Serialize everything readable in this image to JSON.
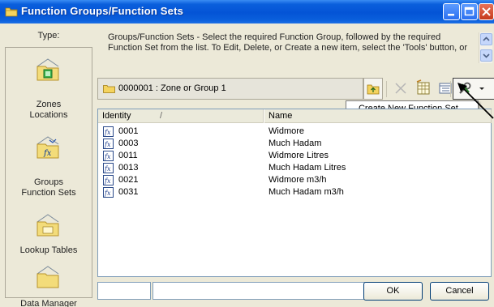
{
  "window": {
    "title": "Function Groups/Function Sets"
  },
  "left": {
    "type_label": "Type:",
    "items": [
      {
        "label": "Zones\nLocations",
        "icon": "zones-folder-icon"
      },
      {
        "label": "Groups\nFunction Sets",
        "icon": "function-folder-icon"
      },
      {
        "label": "Lookup Tables",
        "icon": "lookup-folder-icon"
      },
      {
        "label": "Data Manager",
        "icon": "data-manager-folder-icon"
      }
    ]
  },
  "description": "Groups/Function Sets - Select the required Function Group, followed by the required Function Set from the list. To Edit, Delete, or Create a new item, select the 'Tools' button, or",
  "path": {
    "value": "0000001  :  Zone or Group 1"
  },
  "tools_menu": {
    "items": [
      "Create New Function Set..."
    ]
  },
  "list": {
    "columns": [
      "Identity",
      "Name"
    ],
    "sort_indicator": "/",
    "rows": [
      {
        "id": "0001",
        "name": "Widmore"
      },
      {
        "id": "0003",
        "name": "Much Hadam"
      },
      {
        "id": "0011",
        "name": "Widmore Litres"
      },
      {
        "id": "0013",
        "name": "Much Hadam Litres"
      },
      {
        "id": "0021",
        "name": "Widmore m3/h"
      },
      {
        "id": "0031",
        "name": "Much Hadam m3/h"
      }
    ]
  },
  "buttons": {
    "ok": "OK",
    "cancel": "Cancel"
  },
  "colors": {
    "titlebar": "#0454d6",
    "face": "#ece9d8",
    "list_border": "#7f9db9"
  }
}
